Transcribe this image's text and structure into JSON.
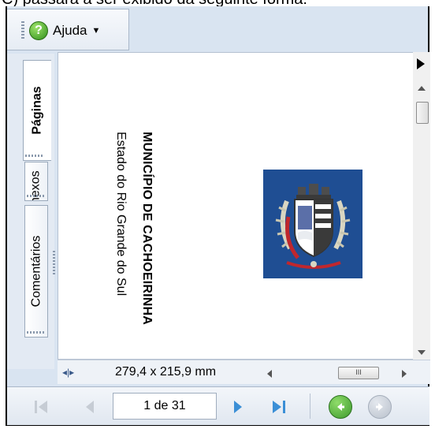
{
  "caption": "C) passará a ser exibido da seguinte forma:",
  "toolbar": {
    "help_label": "Ajuda",
    "help_icon": "help-icon"
  },
  "tabs": [
    {
      "label": "Páginas",
      "active": true
    },
    {
      "label": "Anexos",
      "active": false
    },
    {
      "label": "Comentários",
      "active": false
    }
  ],
  "document": {
    "title": "MUNICÍPIO DE CACHOEIRINHA",
    "subtitle": "Estado do Rio Grande do Sul",
    "crest_color": "#1f4e93"
  },
  "status": {
    "page_size": "279,4 x 215,9 mm",
    "hscroll_thumb": "III"
  },
  "navigation": {
    "page_indicator": "1 de 31"
  },
  "colors": {
    "accent_blue": "#3b8fd6",
    "go_green": "#3e9a2d",
    "disabled_gray": "#c6ccd4"
  }
}
